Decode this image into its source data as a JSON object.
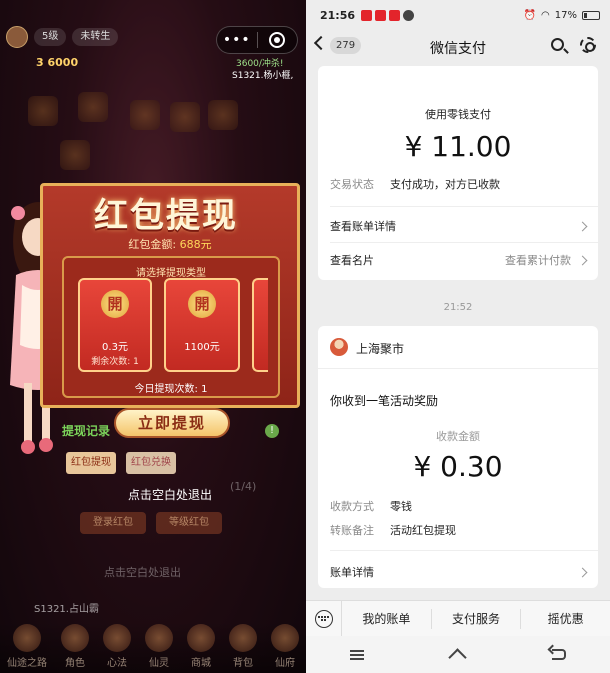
{
  "game": {
    "top_pills": [
      "5级",
      "未转生"
    ],
    "gold": "3 6000",
    "progress": "3600/冲杀!",
    "server_line": "S1321.杨小榧,",
    "panel_title": "红包提现",
    "balance_label": "红包金额:",
    "balance_amount": "688元",
    "select_type": "请选择提现类型",
    "cards": [
      {
        "open_label": "開",
        "value": "0.3元",
        "remaining": "剩余次数: 1"
      },
      {
        "open_label": "開",
        "value": "1100元",
        "remaining": ""
      }
    ],
    "today_count": "今日提现次数: 1",
    "withdraw_button": "立即提现",
    "record_link": "提现记录",
    "help_icon": "!",
    "tabs": [
      "红包提现",
      "红包兑换"
    ],
    "exit_hint": "点击空白处退出",
    "ghost_buttons": [
      "登录红包",
      "等级红包"
    ],
    "ghost_fraction": "(1/4)",
    "ghost_hint": "点击空白处退出",
    "chat_line": "S1321.占山霸",
    "bottom_nav": [
      "仙途之路",
      "角色",
      "心法",
      "仙灵",
      "商城",
      "背包",
      "仙府"
    ]
  },
  "wechat": {
    "status": {
      "time": "21:56",
      "battery": "17%",
      "app_icon_colors": [
        "#e3242b",
        "#e3242b",
        "#e3242b",
        "#444444"
      ]
    },
    "nav": {
      "badge": "279",
      "title": "微信支付"
    },
    "payment_card": {
      "caption": "使用零钱支付",
      "amount": "¥ 11.00",
      "status_label": "交易状态",
      "status_value": "支付成功，对方已收款",
      "bill_detail": "查看账单详情",
      "business_card": "查看名片",
      "cumulative": "查看累计付款"
    },
    "time_separator": "21:52",
    "reward_card": {
      "merchant": "上海聚市",
      "headline": "你收到一笔活动奖励",
      "amount_label": "收款金额",
      "amount": "¥ 0.30",
      "method_label": "收款方式",
      "method_value": "零钱",
      "note_label": "转账备注",
      "note_value": "活动红包提现",
      "bill_detail": "账单详情"
    },
    "bottom_bar": [
      "我的账单",
      "支付服务",
      "摇优惠"
    ]
  },
  "colors": {
    "red_panel": "#b43a2a",
    "gold_border": "#e8b15a",
    "wechat_bg": "#ededed"
  }
}
